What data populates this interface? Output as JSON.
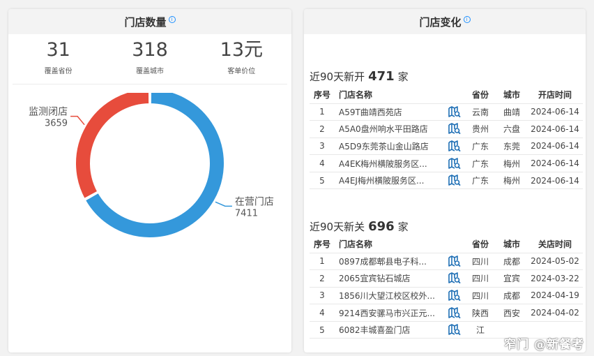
{
  "left_panel": {
    "title": "门店数量",
    "stats": [
      {
        "value": "31",
        "label": "覆盖省份"
      },
      {
        "value": "318",
        "label": "覆盖城市"
      },
      {
        "value": "13元",
        "label": "客单价位"
      }
    ]
  },
  "chart_data": {
    "type": "pie",
    "categories": [
      "在营门店",
      "监测闭店"
    ],
    "values": [
      7411,
      3659
    ],
    "colors": [
      "#3498db",
      "#e74c3c"
    ],
    "labels": [
      {
        "name": "在营门店",
        "value": "7411"
      },
      {
        "name": "监测闭店",
        "value": "3659"
      }
    ]
  },
  "right_panel": {
    "title": "门店变化",
    "opened": {
      "prefix": "近90天新开",
      "count": "471",
      "suffix": "家",
      "headers": [
        "序号",
        "门店名称",
        "省份",
        "城市",
        "开店时间"
      ],
      "rows": [
        {
          "no": "1",
          "name": "A59T曲靖西苑店",
          "prov": "云南",
          "city": "曲靖",
          "date": "2024-06-14"
        },
        {
          "no": "2",
          "name": "A5A0盘州响水平田路店",
          "prov": "贵州",
          "city": "六盘",
          "date": "2024-06-14"
        },
        {
          "no": "3",
          "name": "A5D9东莞茶山金山路店",
          "prov": "广东",
          "city": "东莞",
          "date": "2024-06-14"
        },
        {
          "no": "4",
          "name": "A4EK梅州横陂服务区...",
          "prov": "广东",
          "city": "梅州",
          "date": "2024-06-14"
        },
        {
          "no": "5",
          "name": "A4EJ梅州横陂服务区...",
          "prov": "广东",
          "city": "梅州",
          "date": "2024-06-14"
        }
      ]
    },
    "closed": {
      "prefix": "近90天新关",
      "count": "696",
      "suffix": "家",
      "headers": [
        "序号",
        "门店名称",
        "省份",
        "城市",
        "关店时间"
      ],
      "rows": [
        {
          "no": "1",
          "name": "0897成都郫县电子科...",
          "prov": "四川",
          "city": "成都",
          "date": "2024-05-02"
        },
        {
          "no": "2",
          "name": "2065宜宾钻石城店",
          "prov": "四川",
          "city": "宜宾",
          "date": "2024-03-22"
        },
        {
          "no": "3",
          "name": "1856川大望江校区校外...",
          "prov": "四川",
          "city": "成都",
          "date": "2024-04-19"
        },
        {
          "no": "4",
          "name": "9214西安骡马市兴正元...",
          "prov": "陕西",
          "city": "西安",
          "date": "2024-04-02"
        },
        {
          "no": "5",
          "name": "6082丰城喜盈门店",
          "prov": "江",
          "city": "",
          "date": ""
        }
      ]
    }
  },
  "watermark": "窄门 @新餐考"
}
